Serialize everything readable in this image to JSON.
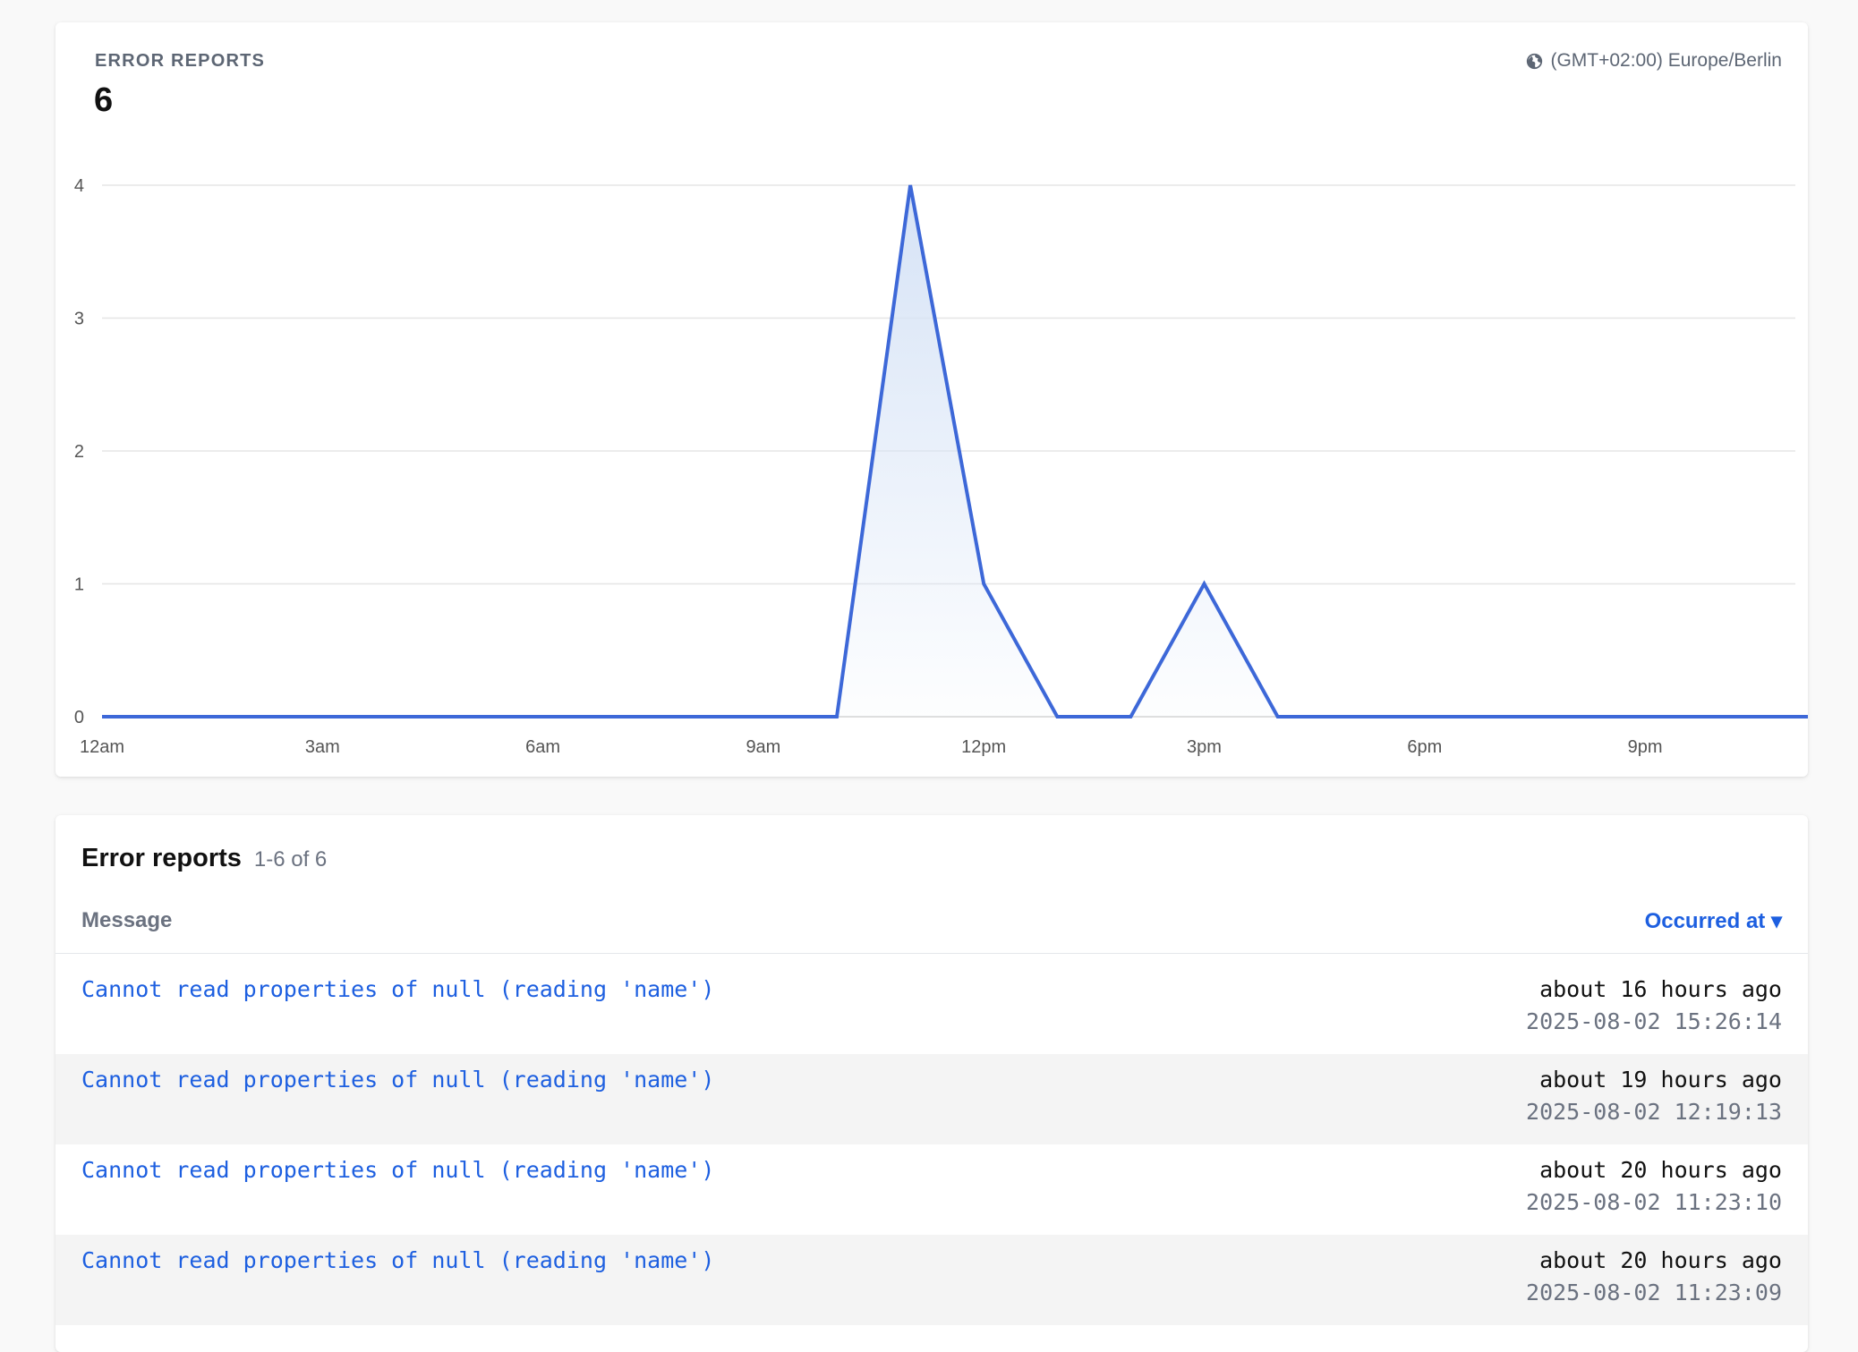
{
  "chart_card": {
    "label": "ERROR REPORTS",
    "total": "6",
    "timezone": "(GMT+02:00) Europe/Berlin",
    "timezone_icon": "globe-icon"
  },
  "chart_data": {
    "type": "area",
    "x": [
      "12am",
      "1am",
      "2am",
      "3am",
      "4am",
      "5am",
      "6am",
      "7am",
      "8am",
      "9am",
      "10am",
      "11am",
      "12pm",
      "1pm",
      "2pm",
      "3pm",
      "4pm",
      "5pm",
      "6pm",
      "7pm",
      "8pm",
      "9pm",
      "10pm",
      "11pm"
    ],
    "series": [
      {
        "values": [
          0,
          0,
          0,
          0,
          0,
          0,
          0,
          0,
          0,
          0,
          0,
          4,
          1,
          0,
          0,
          1,
          0,
          0,
          0,
          0,
          0,
          0,
          0,
          0
        ]
      }
    ],
    "x_tick_labels": [
      "12am",
      "3am",
      "6am",
      "9am",
      "12pm",
      "3pm",
      "6pm",
      "9pm"
    ],
    "y_ticks": [
      0,
      1,
      2,
      3,
      4
    ],
    "ylim": [
      0,
      4
    ],
    "grid": true,
    "colors": {
      "line": "#3d68d8",
      "fill": "#dbe6f7"
    }
  },
  "reports": {
    "title": "Error reports",
    "count_text": "1-6 of 6",
    "columns": {
      "message": "Message",
      "occurred": "Occurred at ▾"
    },
    "rows": [
      {
        "message": "Cannot read properties of null (reading 'name')",
        "ago": "about 16 hours ago",
        "timestamp": "2025-08-02 15:26:14"
      },
      {
        "message": "Cannot read properties of null (reading 'name')",
        "ago": "about 19 hours ago",
        "timestamp": "2025-08-02 12:19:13"
      },
      {
        "message": "Cannot read properties of null (reading 'name')",
        "ago": "about 20 hours ago",
        "timestamp": "2025-08-02 11:23:10"
      },
      {
        "message": "Cannot read properties of null (reading 'name')",
        "ago": "about 20 hours ago",
        "timestamp": "2025-08-02 11:23:09"
      }
    ]
  }
}
